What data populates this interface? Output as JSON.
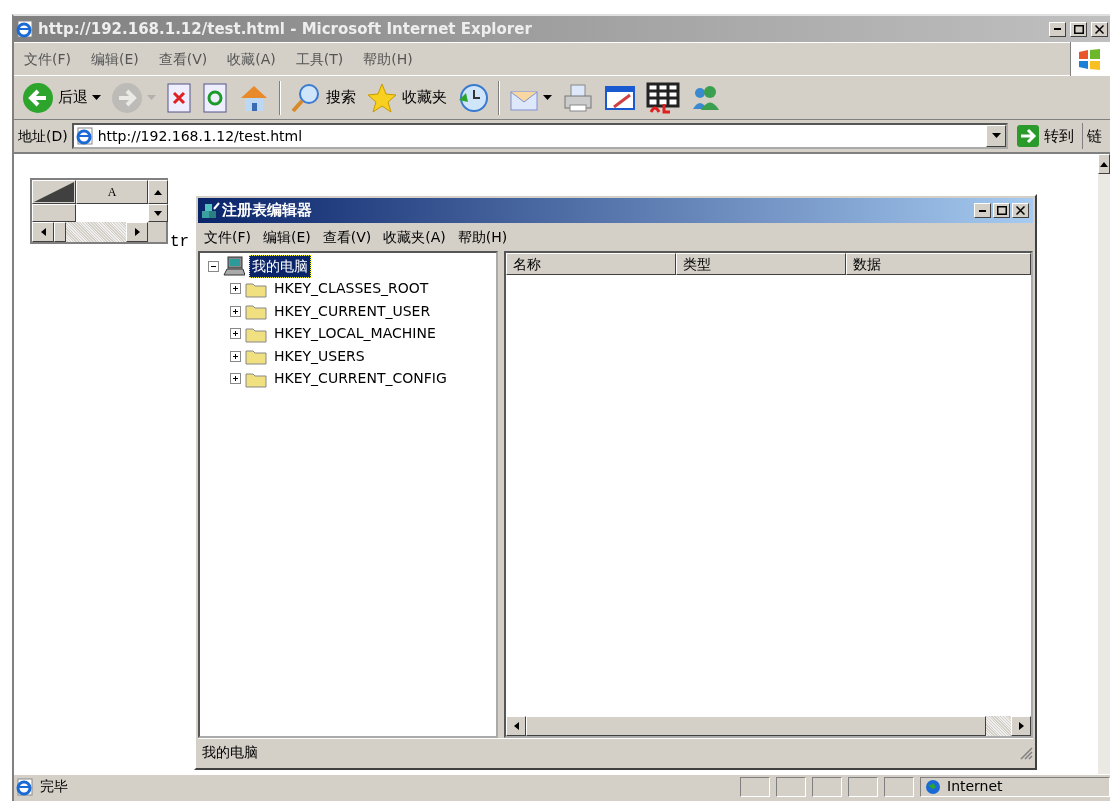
{
  "browser": {
    "title": "http://192.168.1.12/test.html - Microsoft Internet Explorer",
    "menu": [
      "文件(F)",
      "编辑(E)",
      "查看(V)",
      "收藏(A)",
      "工具(T)",
      "帮助(H)"
    ],
    "toolbar": [
      {
        "kind": "back",
        "label": "后退",
        "dropdown": true,
        "disabled": false
      },
      {
        "kind": "forward",
        "dropdown": true,
        "disabled": true
      },
      {
        "kind": "stop",
        "dropdown": false,
        "disabled": false
      },
      {
        "kind": "refresh",
        "dropdown": false,
        "disabled": false
      },
      {
        "kind": "home",
        "dropdown": false,
        "disabled": false
      },
      {
        "kind": "separator"
      },
      {
        "kind": "search",
        "label": "搜索",
        "dropdown": false,
        "disabled": false
      },
      {
        "kind": "favorites",
        "label": "收藏夹",
        "dropdown": false,
        "disabled": false
      },
      {
        "kind": "history",
        "dropdown": false,
        "disabled": false
      },
      {
        "kind": "separator"
      },
      {
        "kind": "mail",
        "dropdown": true,
        "disabled": false
      },
      {
        "kind": "print",
        "dropdown": false,
        "disabled": false
      },
      {
        "kind": "edit",
        "dropdown": false,
        "disabled": false
      },
      {
        "kind": "grid",
        "dropdown": false,
        "disabled": false
      },
      {
        "kind": "messenger",
        "dropdown": false,
        "disabled": false
      }
    ],
    "address": {
      "label": "地址(D)",
      "value": "http://192.168.1.12/test.html",
      "go": "转到",
      "links": "链"
    },
    "status": {
      "text": "完毕",
      "zone": "Internet"
    }
  },
  "page": {
    "grid": {
      "column": "A"
    },
    "text": "tr"
  },
  "regedit": {
    "title": "注册表编辑器",
    "menu": [
      "文件(F)",
      "编辑(E)",
      "查看(V)",
      "收藏夹(A)",
      "帮助(H)"
    ],
    "tree": [
      {
        "label": "我的电脑",
        "expanded": true,
        "selected": true,
        "children": [
          {
            "label": "HKEY_CLASSES_ROOT",
            "expanded": false,
            "selected": false
          },
          {
            "label": "HKEY_CURRENT_USER",
            "expanded": false,
            "selected": false
          },
          {
            "label": "HKEY_LOCAL_MACHINE",
            "expanded": false,
            "selected": false
          },
          {
            "label": "HKEY_USERS",
            "expanded": false,
            "selected": false
          },
          {
            "label": "HKEY_CURRENT_CONFIG",
            "expanded": false,
            "selected": false
          }
        ]
      }
    ],
    "columns": [
      "名称",
      "类型",
      "数据"
    ],
    "status": "我的电脑"
  }
}
